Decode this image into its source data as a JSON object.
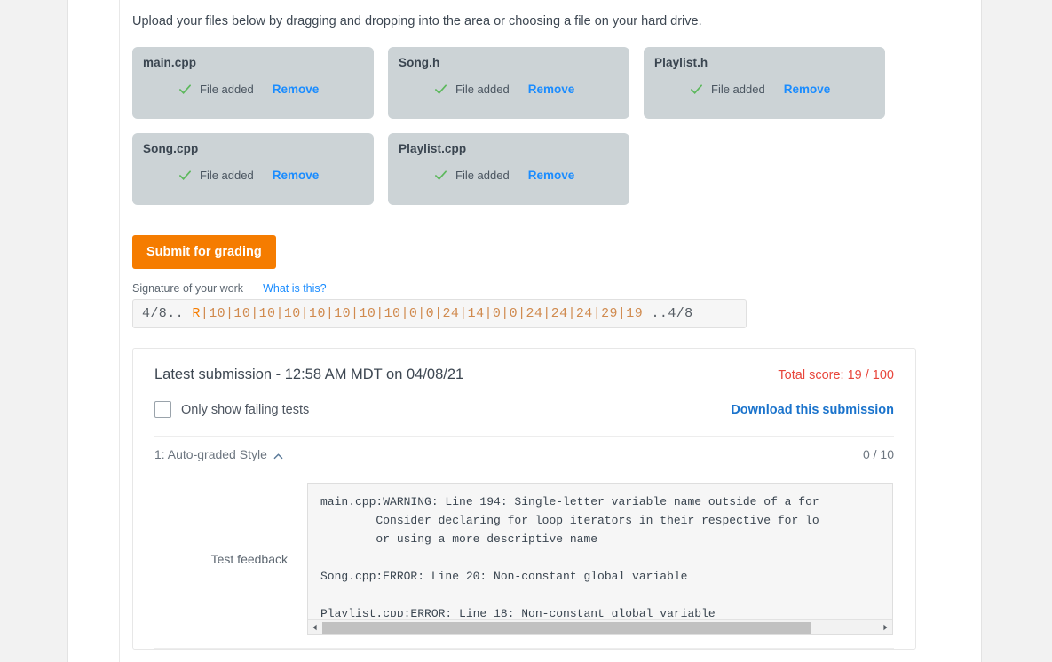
{
  "upload": {
    "instructions": "Upload your files below by dragging and dropping into the area or choosing a file on your hard drive.",
    "files": [
      {
        "name": "main.cpp",
        "status": "File added",
        "remove_label": "Remove"
      },
      {
        "name": "Song.h",
        "status": "File added",
        "remove_label": "Remove"
      },
      {
        "name": "Playlist.h",
        "status": "File added",
        "remove_label": "Remove"
      },
      {
        "name": "Song.cpp",
        "status": "File added",
        "remove_label": "Remove"
      },
      {
        "name": "Playlist.cpp",
        "status": "File added",
        "remove_label": "Remove"
      }
    ]
  },
  "submit": {
    "button_label": "Submit for grading"
  },
  "signature": {
    "label": "Signature of your work",
    "help_label": "What is this?",
    "prefix": "4/8.. ",
    "flag": "R",
    "body": "|10|10|10|10|10|10|10|10|0|0|24|14|0|0|24|24|24|29|19",
    "suffix": " ..4/8",
    "full_value": "4/8.. R|10|10|10|10|10|10|10|10|0|0|24|14|0|0|24|24|24|29|19 ..4/8"
  },
  "submission": {
    "title": "Latest submission - 12:58 AM MDT on 04/08/21",
    "total_score": "Total score: 19 / 100",
    "failing_tests_label": "Only show failing tests",
    "failing_tests_checked": false,
    "download_label": "Download this submission",
    "test": {
      "name": "1: Auto-graded Style",
      "score": "0 / 10",
      "expanded": true,
      "feedback_label": "Test feedback",
      "feedback_text": "main.cpp:WARNING: Line 194: Single-letter variable name outside of a for\n        Consider declaring for loop iterators in their respective for lo\n        or using a more descriptive name\n\nSong.cpp:ERROR: Line 20: Non-constant global variable\n\nPlaylist.cpp:ERROR: Line 18: Non-constant global variable"
    }
  },
  "colors": {
    "accent_orange": "#f57c00",
    "link_blue": "#1a8cff",
    "download_blue": "#1a73cc",
    "score_red": "#e8463c",
    "card_gray": "#ccd3d6",
    "check_green": "#5cb85c"
  },
  "icons": {
    "check": "check-icon",
    "chevron_up": "chevron-up-icon",
    "scroll_left": "scroll-left-arrow-icon",
    "scroll_right": "scroll-right-arrow-icon"
  }
}
